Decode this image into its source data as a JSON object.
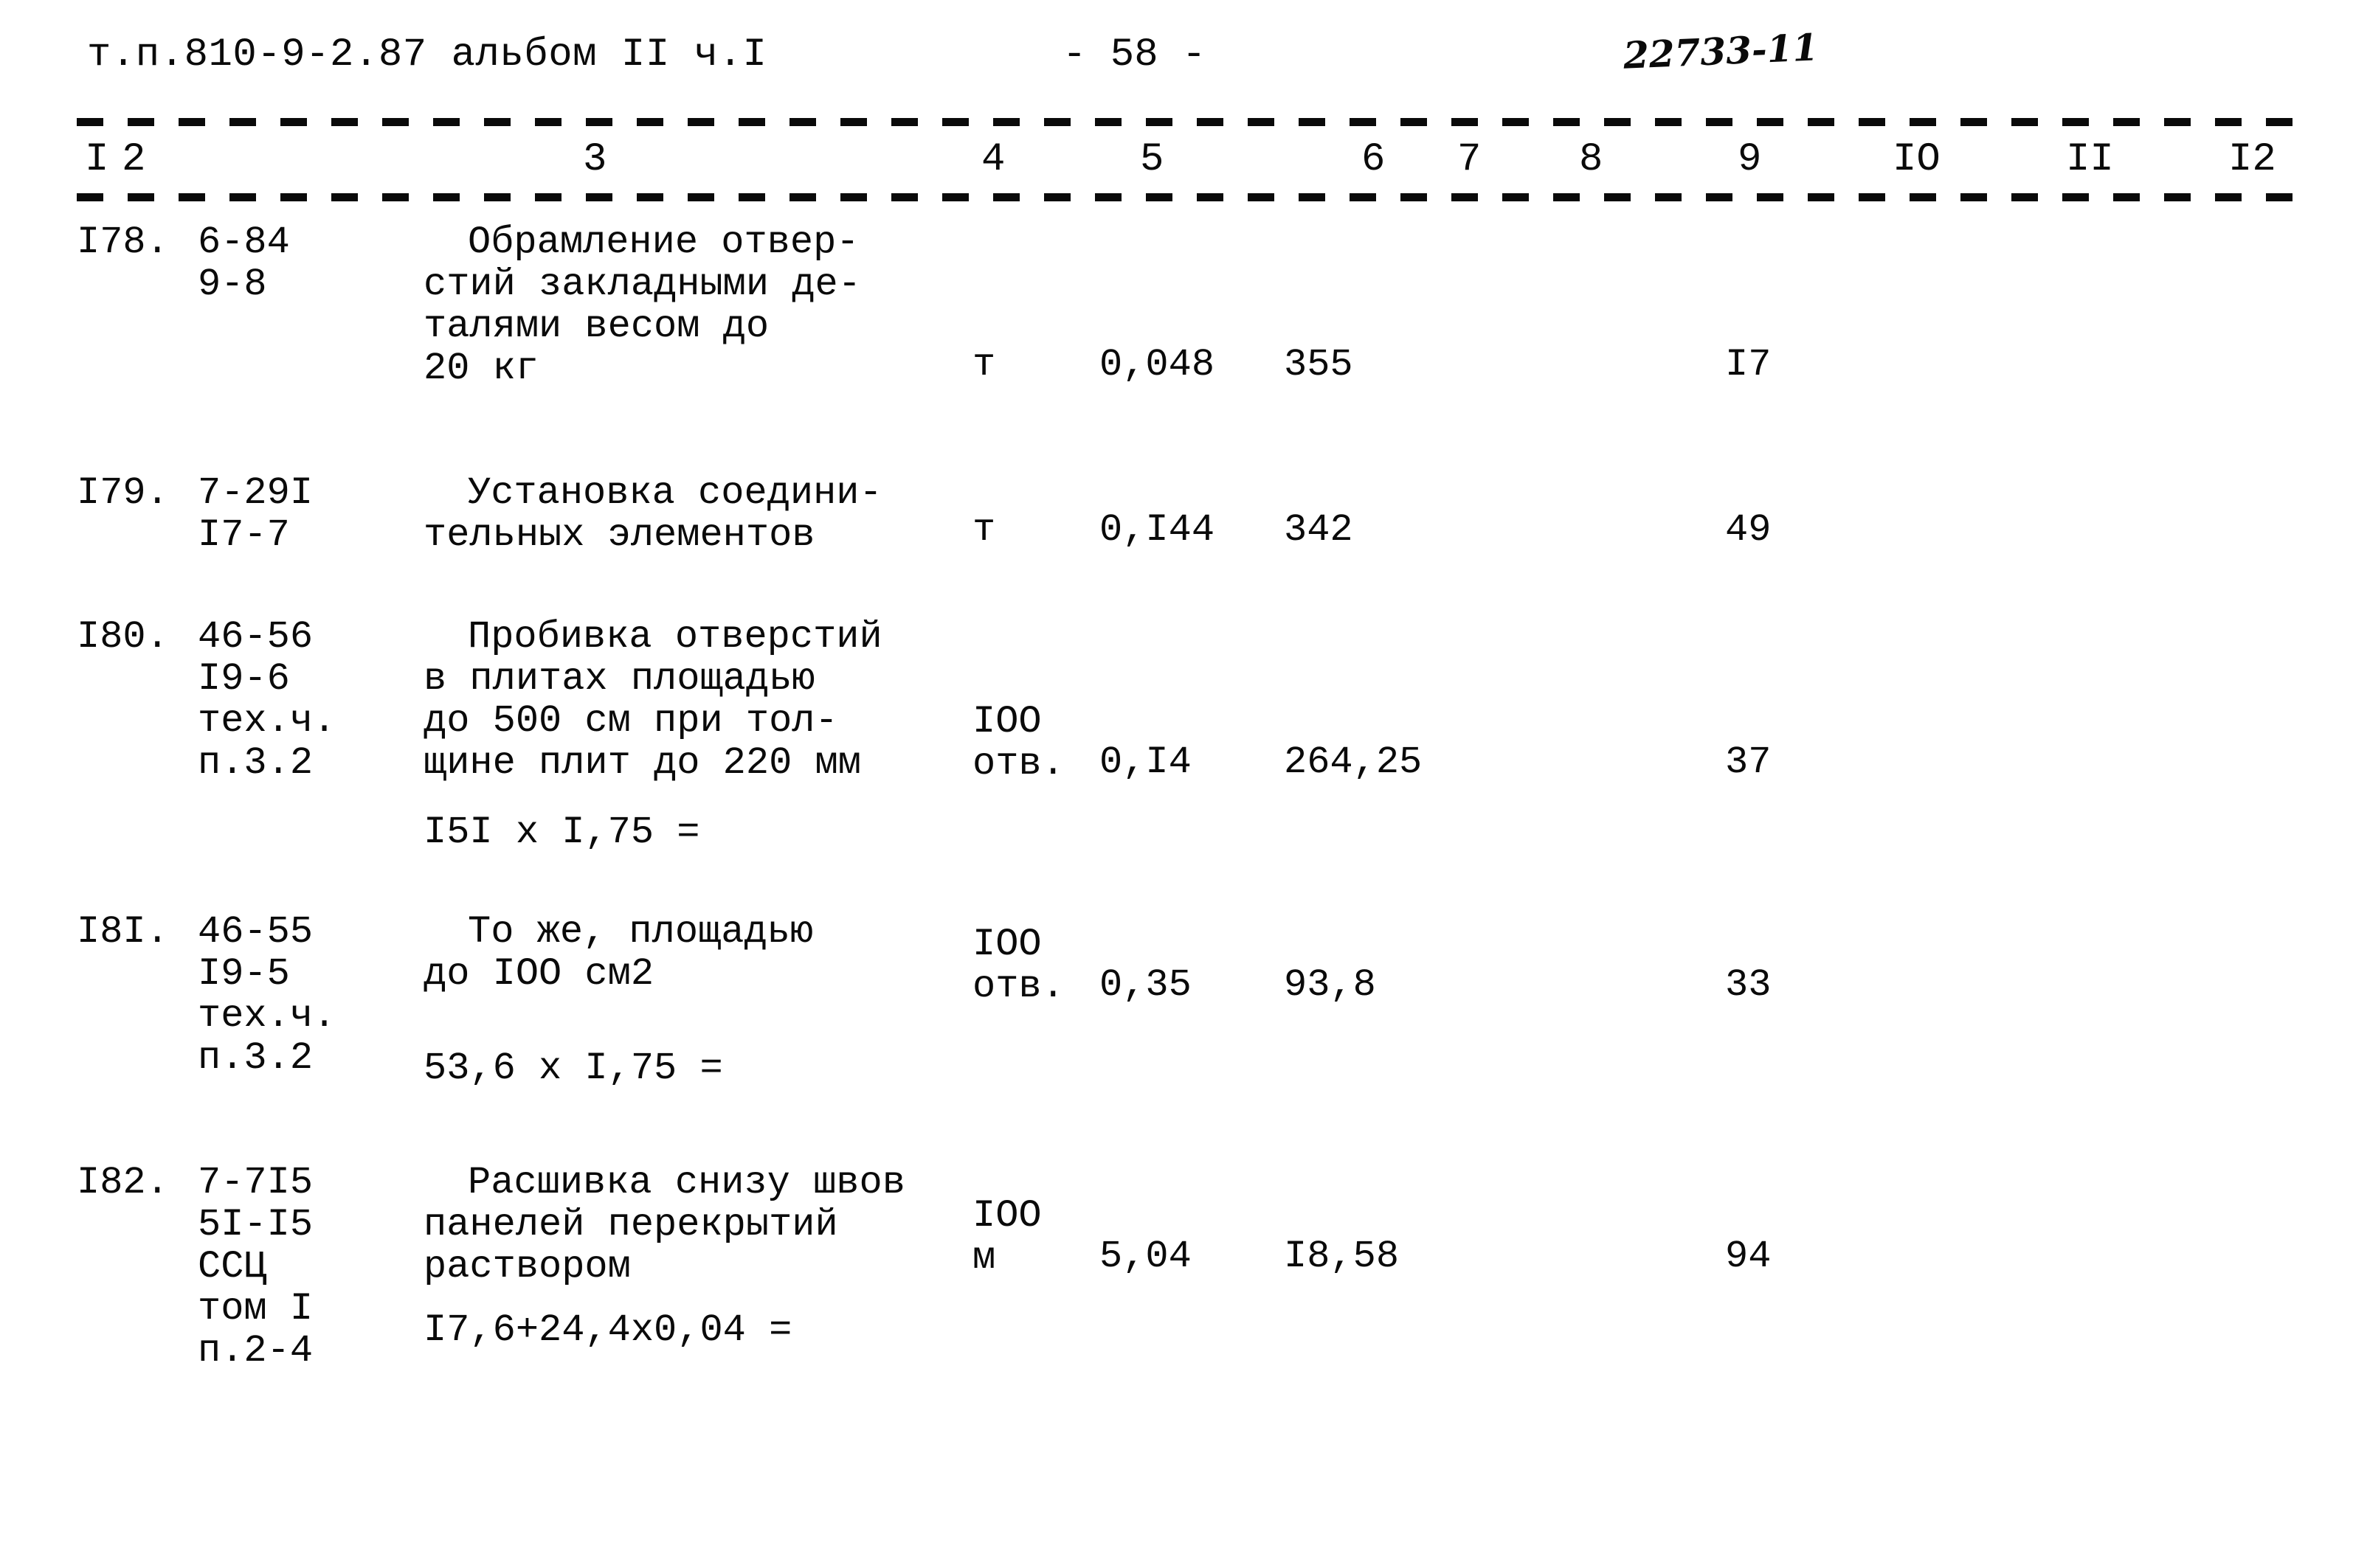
{
  "header": {
    "doc_code": "т.п.810-9-2.87 альбом II ч.I",
    "page_number": "- 58 -",
    "stamp_number": "22733-11"
  },
  "table": {
    "column_headers": [
      "I",
      "2",
      "3",
      "4",
      "5",
      "6",
      "7",
      "8",
      "9",
      "IO",
      "II",
      "I2"
    ],
    "rows": [
      {
        "num": "I78.",
        "code": "6-84\n9-8",
        "desc_first": "Обрамление отвер-",
        "desc_rest": "стий закладными де-\nталями весом до\n20 кг",
        "unit": "т",
        "qty": "0,048",
        "price": "355",
        "col9": "I7",
        "formula": ""
      },
      {
        "num": "I79.",
        "code": "7-29I\nI7-7",
        "desc_first": "Установка соедини-",
        "desc_rest": "тельных элементов",
        "unit": "т",
        "qty": "0,I44",
        "price": "342",
        "col9": "49",
        "formula": ""
      },
      {
        "num": "I80.",
        "code": "46-56\nI9-6\nтех.ч.\nп.3.2",
        "desc_first": "Пробивка отверстий",
        "desc_rest": "в плитах площадью\nдо 500 см при тол-\nщине плит до 220 мм",
        "unit": "IOO\nотв.",
        "qty": "0,I4",
        "price": "264,25",
        "col9": "37",
        "formula": "I5I x I,75 ="
      },
      {
        "num": "I8I.",
        "code": "46-55\nI9-5\nтех.ч.\nп.3.2",
        "desc_first": "То же, площадью",
        "desc_rest": "до IOO см2",
        "unit": "IOO\nотв.",
        "qty": "0,35",
        "price": "93,8",
        "col9": "33",
        "formula": "53,6 x I,75 ="
      },
      {
        "num": "I82.",
        "code": "7-7I5\n5I-I5\nССЦ\nтом I\nп.2-4",
        "desc_first": "Расшивка снизу швов",
        "desc_rest": "панелей перекрытий\nраствором",
        "unit": "IOO\nм",
        "qty": "5,04",
        "price": "I8,58",
        "col9": "94",
        "formula": "I7,6+24,4x0,04 ="
      }
    ]
  }
}
